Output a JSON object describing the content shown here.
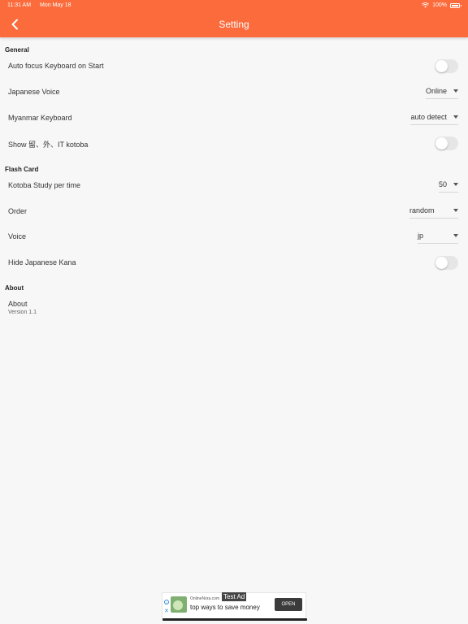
{
  "status_bar": {
    "time": "11:31 AM",
    "date": "Mon May 18",
    "battery": "100%"
  },
  "header": {
    "title": "Setting",
    "back_icon": "chevron-left-icon"
  },
  "sections": {
    "general": {
      "title": "General",
      "auto_focus": {
        "label": "Auto focus Keyboard on Start",
        "enabled": false
      },
      "japanese_voice": {
        "label": "Japanese Voice",
        "value": "Online"
      },
      "myanmar_keyboard": {
        "label": "Myanmar Keyboard",
        "value": "auto detect"
      },
      "show_kotoba": {
        "label": "Show 留、外、IT kotoba",
        "enabled": false
      }
    },
    "flash_card": {
      "title": "Flash Card",
      "kotoba_study": {
        "label": "Kotoba Study per time",
        "value": "50"
      },
      "order": {
        "label": "Order",
        "value": "random"
      },
      "voice": {
        "label": "Voice",
        "value": "jp"
      },
      "hide_kana": {
        "label": "Hide Japanese Kana",
        "enabled": false
      }
    },
    "about": {
      "title": "About",
      "item_title": "About",
      "version": "Version 1.1"
    }
  },
  "ad": {
    "tag": "Test Ad",
    "domain": "OnlineNora.com",
    "headline": "top ways to save money",
    "cta": "OPEN"
  },
  "colors": {
    "accent": "#fb6b3c",
    "background": "#f7f7f7",
    "toggle_off": "#e6e6e6"
  }
}
